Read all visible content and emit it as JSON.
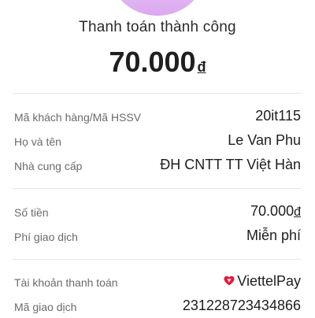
{
  "status": {
    "title": "Thanh toán thành công"
  },
  "amount": {
    "value": "70.000",
    "currency": "đ"
  },
  "customer_section": [
    {
      "label": "Mã khách hàng/Mã HSSV",
      "value": "20it115"
    },
    {
      "label": "Họ và tên",
      "value": "Le Van Phu"
    },
    {
      "label": "Nhà cung cấp",
      "value": "ĐH CNTT TT Việt Hàn"
    }
  ],
  "payment_section": {
    "amount": {
      "label": "Số tiền",
      "value": "70.000",
      "currency": "đ"
    },
    "fee": {
      "label": "Phí giao dịch",
      "value": "Miễn phí"
    }
  },
  "account_section": {
    "account": {
      "label": "Tài khoản thanh toán",
      "value": "ViettelPay",
      "icon": "viettelpay-logo-icon"
    },
    "transaction": {
      "label": "Mã giao dịch",
      "value": "231228723434866"
    }
  },
  "colors": {
    "illustration": "#dca8f0",
    "illustration_accent": "#c97fe8",
    "viettel_red": "#e5173f",
    "divider": "#e6e6e6",
    "label_gray": "#6a6a6a"
  }
}
